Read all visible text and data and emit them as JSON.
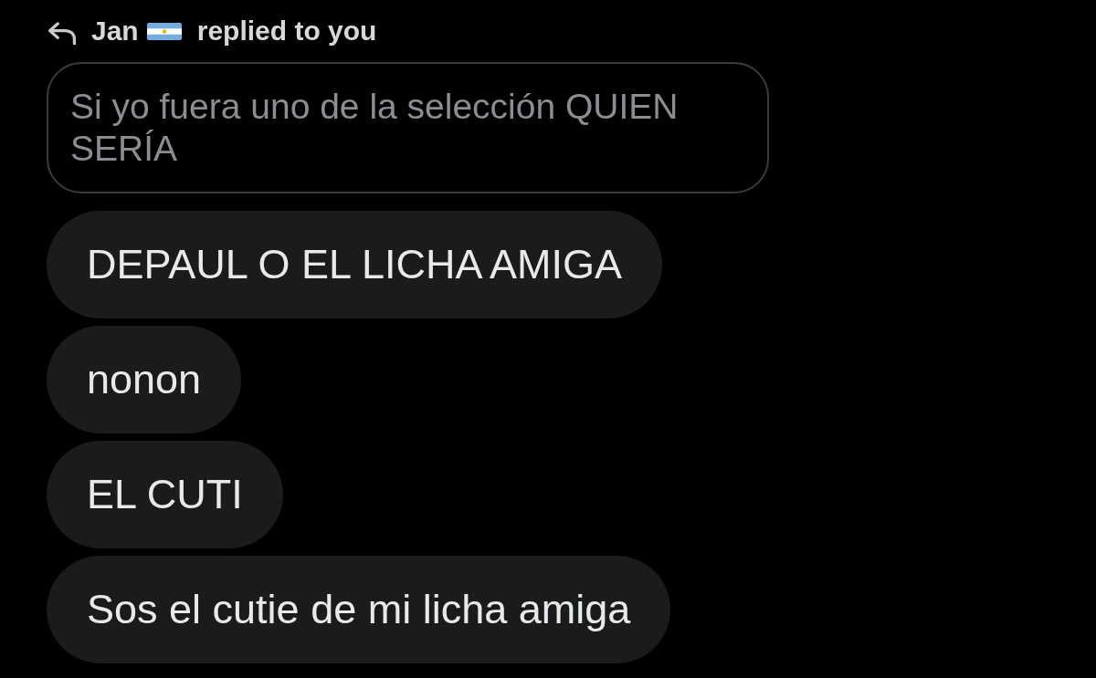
{
  "notification": {
    "sender": "Jan",
    "action": "replied to you"
  },
  "quoted_message": {
    "text": "Si yo fuera uno de la selección QUIEN SERÍA"
  },
  "messages": [
    {
      "text": "DEPAUL O EL LICHA AMIGA"
    },
    {
      "text": "nonon"
    },
    {
      "text": "EL CUTI"
    },
    {
      "text": "Sos el cutie de mi licha amiga"
    }
  ]
}
